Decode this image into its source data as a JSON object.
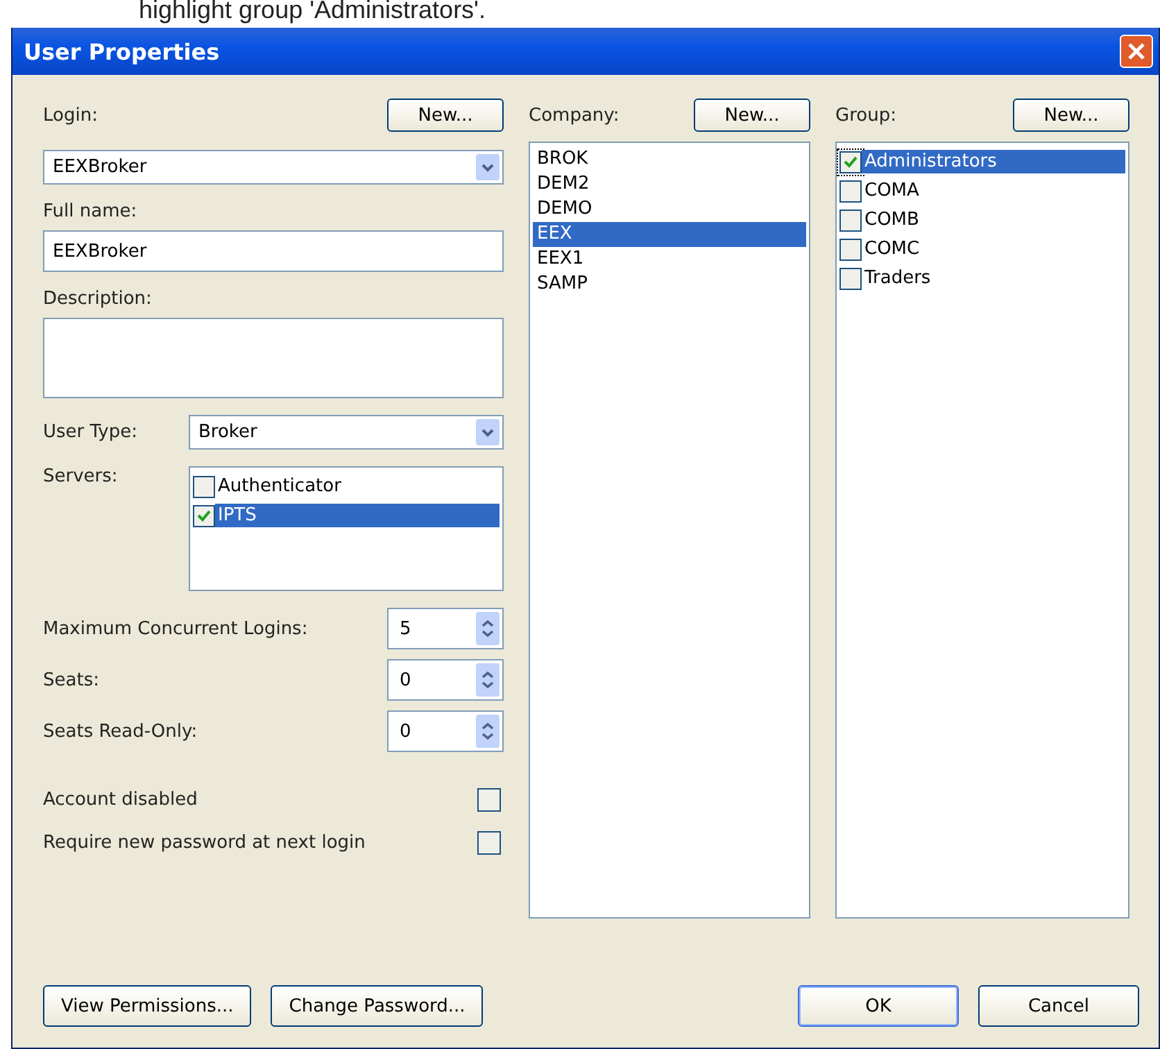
{
  "caption": "highlight group 'Administrators'.",
  "window": {
    "title": "User Properties"
  },
  "login": {
    "label": "Login:",
    "new_button": "New...",
    "value": "EEXBroker"
  },
  "full_name": {
    "label": "Full name:",
    "value": "EEXBroker"
  },
  "description": {
    "label": "Description:"
  },
  "user_type": {
    "label": "User Type:",
    "value": "Broker"
  },
  "servers": {
    "label": "Servers:",
    "items": [
      {
        "label": "Authenticator",
        "checked": false,
        "selected": false
      },
      {
        "label": "IPTS",
        "checked": true,
        "selected": true
      }
    ]
  },
  "spinners": [
    {
      "label": "Maximum Concurrent Logins:",
      "value": "5"
    },
    {
      "label": "Seats:",
      "value": "0"
    },
    {
      "label": "Seats Read-Only:",
      "value": "0"
    }
  ],
  "options": [
    {
      "label": "Account disabled",
      "checked": false
    },
    {
      "label": "Require new password at next login",
      "checked": false
    }
  ],
  "company": {
    "label": "Company:",
    "new_button": "New...",
    "items": [
      {
        "label": "BROK",
        "selected": false
      },
      {
        "label": "DEM2",
        "selected": false
      },
      {
        "label": "DEMO",
        "selected": false
      },
      {
        "label": "EEX",
        "selected": true
      },
      {
        "label": "EEX1",
        "selected": false
      },
      {
        "label": "SAMP",
        "selected": false
      }
    ]
  },
  "group": {
    "label": "Group:",
    "new_button": "New...",
    "items": [
      {
        "label": "Administrators",
        "checked": true,
        "selected": true
      },
      {
        "label": "COMA",
        "checked": false,
        "selected": false
      },
      {
        "label": "COMB",
        "checked": false,
        "selected": false
      },
      {
        "label": "COMC",
        "checked": false,
        "selected": false
      },
      {
        "label": "Traders",
        "checked": false,
        "selected": false
      }
    ]
  },
  "buttons": {
    "left": [
      "View Permissions...",
      "Change Password..."
    ],
    "right": [
      "OK",
      "Cancel"
    ]
  }
}
